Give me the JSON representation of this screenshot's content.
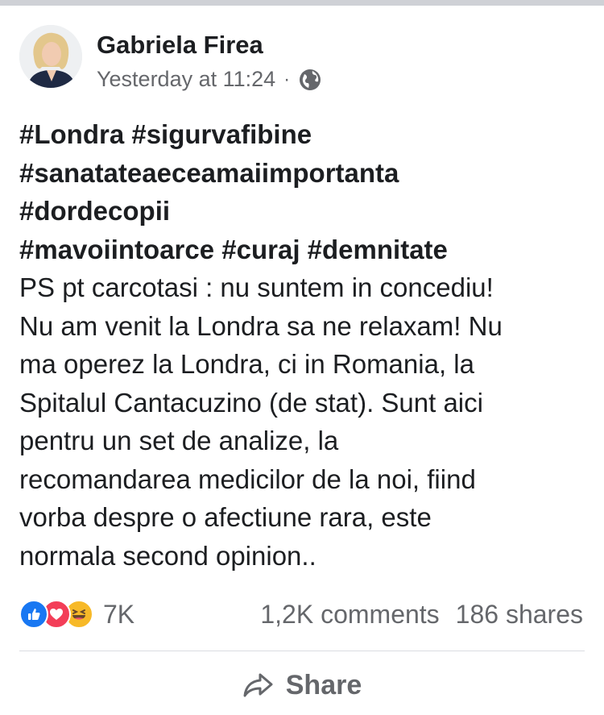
{
  "post": {
    "author": "Gabriela Firea",
    "timestamp": "Yesterday at 11:24",
    "separator": "·",
    "privacy_icon": "globe-icon",
    "hashtag_lines": [
      "#Londra #sigurvafibine",
      "#sanatateaeceamaiimportanta",
      "#dordecopii",
      "#mavoiintoarce #curaj #demnitate"
    ],
    "body_lines": [
      "PS  pt carcotasi : nu suntem in concediu!",
      "Nu am venit la Londra sa ne relaxam! Nu",
      "ma operez la Londra, ci in Romania, la",
      "Spitalul Cantacuzino (de stat). Sunt aici",
      "pentru un set de analize, la",
      "recomandarea medicilor de la noi, fiind",
      "vorba despre o afectiune rara, este",
      "normala second opinion.."
    ]
  },
  "stats": {
    "reaction_icons": [
      "like-icon",
      "love-icon",
      "haha-icon"
    ],
    "reaction_count": "7K",
    "comments": "1,2K comments",
    "shares": "186 shares"
  },
  "actions": {
    "share_label": "Share"
  },
  "colors": {
    "text": "#1c1e21",
    "secondary": "#65676b",
    "like": "#1877f2",
    "love": "#f33e58",
    "haha": "#f7b928",
    "divider": "#dadde1"
  }
}
